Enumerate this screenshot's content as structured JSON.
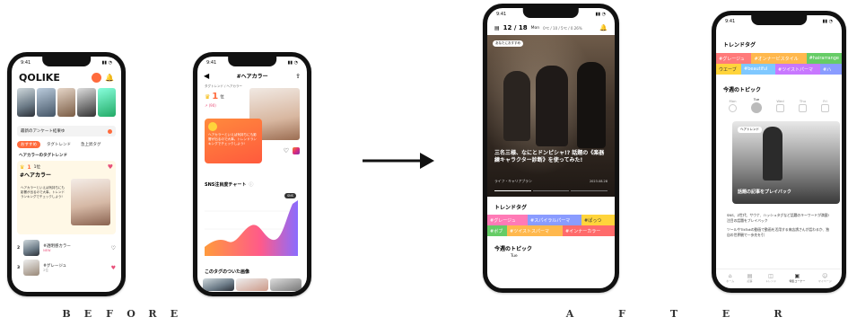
{
  "captions": {
    "before": [
      "B",
      "E",
      "F",
      "O",
      "R",
      "E"
    ],
    "after": [
      "A",
      "F",
      "T",
      "E",
      "R"
    ]
  },
  "colors": {
    "accent": "#ff6b3d",
    "pink": "#e8507a",
    "teal": "#3bbfb4",
    "yellow": "#ffd43b",
    "green": "#66cc66",
    "purple": "#8a6cff"
  },
  "phone1": {
    "time": "9:41",
    "logo": "QOLIKE",
    "notice": "最新のアンケート結果ゆ",
    "tabs": [
      "おすすめ",
      "タグトレンド",
      "急上昇タグ"
    ],
    "section": "ヘアカラーのタグトレンド",
    "rank_num": "1",
    "rank_change": "1位",
    "rank_tag": "#ヘアカラー",
    "card_text": "ヘアカラーといえば気持ちにも影響が出るので大事。トレンドランキングでチェックしよう!",
    "list": [
      {
        "rank": "2",
        "title": "#透明感カラー",
        "badge": "NEW"
      },
      {
        "rank": "3",
        "title": "#グレージュ",
        "badge": "2位"
      }
    ]
  },
  "phone2": {
    "time": "9:41",
    "title": "#ヘアカラー",
    "subtitle": "タグトレンド / ヘアカラー",
    "rank": "1",
    "rank_suffix": "位",
    "change": "↗ (90)",
    "bubble_text": "ヘアカラーといえば気持ちにも影響が出るので大事。トレンドランキングでチェックしよう!",
    "chart_title": "SNS注目度チャート",
    "chart_badge": "SNS",
    "section2": "このタグのついた画像"
  },
  "phone3": {
    "time": "9:41",
    "date": "12 / 18",
    "weekday": "Mon",
    "weather": "0℃ / 10 / 5℃ / 0.26%",
    "hero_badge": "あなたにおすすめ",
    "hero_title": "三名三様、なにとドンピシャ!? 話題の《楽器練キャラクター診断》を使ってみた!",
    "hero_tag": "ライフ・キャリアプラン",
    "hero_date": "2023.08.28",
    "trend_title": "トレンドタグ",
    "tags_row1": [
      "#グレージュ",
      "#スパイラルパーマ",
      "#ぱっつ"
    ],
    "tags_row2": [
      "#ボブ",
      "#ツイストスパーマ",
      "#インナーカラー"
    ],
    "topic_title": "今週のトピック",
    "day_partial": "Tue"
  },
  "phone4": {
    "time": "9:41",
    "trend_title": "トレンドタグ",
    "tags_row1": [
      "#グレージュ",
      "#オンナービスタイル",
      "#hairarrange"
    ],
    "tags_row2": [
      "ウエーブ",
      "#beautiful",
      "#ツイストパーマ",
      "#ハ"
    ],
    "topic_title": "今週のトピック",
    "days": [
      "Mon",
      "Tue",
      "Wed",
      "Thu",
      "Fri"
    ],
    "card_badge": "ヘアトレンド",
    "card_title": "話題の記事をプレイバック",
    "body1": "SNS、Z世代、サウナ、ハッシュタグなど話題のキーワードが満載!注目の話題をプレイバック",
    "body2": "ツールやTikTokの動画で動画を活用する来店誘さんが話わるか、独自の世界観で一歩先を引",
    "nav": [
      "ホーム",
      "記事",
      "トレンド",
      "特集コーナー",
      "マイページ"
    ]
  },
  "arrow": "→"
}
